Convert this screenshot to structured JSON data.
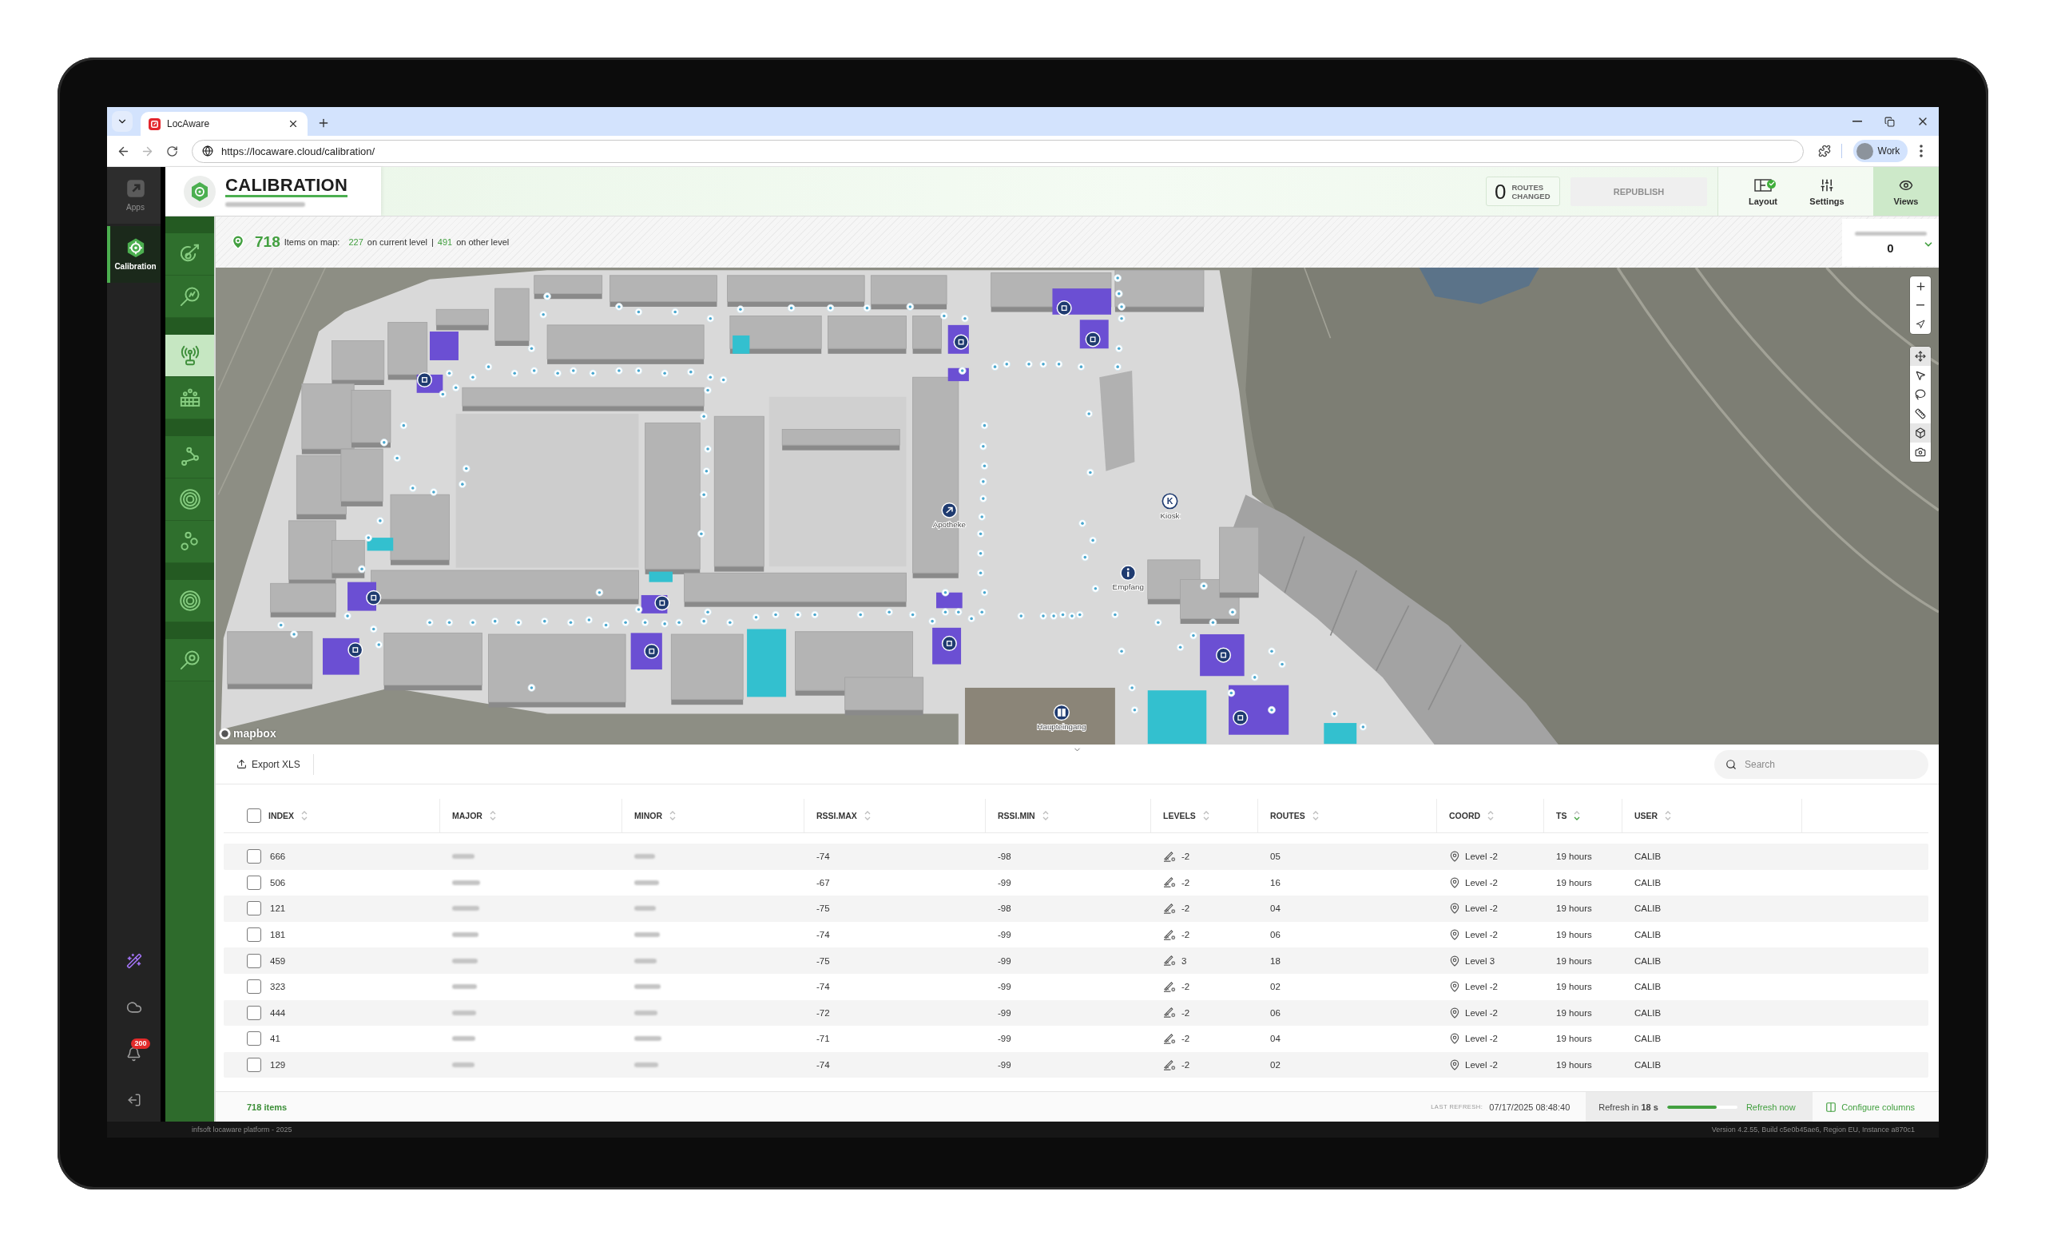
{
  "browser": {
    "tab_title": "LocAware",
    "url": "https://locaware.cloud/calibration/",
    "profile": "Work"
  },
  "sidebar": {
    "items": [
      {
        "label": "Apps",
        "selected": false
      },
      {
        "label": "Calibration",
        "selected": true
      }
    ],
    "notification_badge": "200"
  },
  "header": {
    "title": "CALIBRATION",
    "routes_count": "0",
    "routes_label": "ROUTES CHANGED",
    "republish": {
      "label": "REPUBLISH",
      "disabled": true
    },
    "actions": [
      {
        "label": "Layout",
        "checked": true,
        "selected": false
      },
      {
        "label": "Settings",
        "checked": false,
        "selected": false
      },
      {
        "label": "Views",
        "checked": false,
        "selected": true
      }
    ]
  },
  "tool_groups": [
    {
      "items": [
        {
          "selected": false
        },
        {
          "selected": false
        }
      ]
    },
    {
      "items": [
        {
          "selected": true
        },
        {
          "selected": false
        }
      ]
    },
    {
      "items": [
        {
          "selected": false
        },
        {
          "selected": false
        },
        {
          "selected": false
        }
      ]
    },
    {
      "items": [
        {
          "selected": false
        }
      ]
    },
    {
      "items": [
        {
          "selected": false
        }
      ]
    }
  ],
  "info_bar": {
    "total": "718",
    "total_label": "Items on map:",
    "current": "227",
    "current_label": "on current level",
    "separator": "|",
    "other": "491",
    "other_label": "on other level",
    "side_value": "0"
  },
  "map": {
    "pois": [
      {
        "label": "Apotheke",
        "kind": "pin"
      },
      {
        "label": "Kiosk",
        "kind": "letter",
        "glyph": "K"
      },
      {
        "label": "Empfang",
        "kind": "info"
      },
      {
        "label": "Haupteingang",
        "kind": "door"
      }
    ],
    "attribution": "mapbox"
  },
  "table": {
    "export_label": "Export XLS",
    "search_placeholder": "Search",
    "select_all": false,
    "columns": [
      {
        "label": "INDEX",
        "sorted": false
      },
      {
        "label": "MAJOR",
        "sorted": false
      },
      {
        "label": "MINOR",
        "sorted": false
      },
      {
        "label": "RSSI.MAX",
        "sorted": false
      },
      {
        "label": "RSSI.MIN",
        "sorted": false
      },
      {
        "label": "LEVELS",
        "sorted": false
      },
      {
        "label": "ROUTES",
        "sorted": false
      },
      {
        "label": "COORD",
        "sorted": false
      },
      {
        "label": "TS",
        "sorted": true
      },
      {
        "label": "USER",
        "sorted": false
      }
    ],
    "rows": [
      {
        "checked": false,
        "index": "666",
        "rssi_max": "-74",
        "rssi_min": "-98",
        "levels": "-2",
        "routes": "05",
        "coord": "Level -2",
        "ts": "19 hours",
        "user": "CALIB"
      },
      {
        "checked": false,
        "index": "506",
        "rssi_max": "-67",
        "rssi_min": "-99",
        "levels": "-2",
        "routes": "16",
        "coord": "Level -2",
        "ts": "19 hours",
        "user": "CALIB"
      },
      {
        "checked": false,
        "index": "121",
        "rssi_max": "-75",
        "rssi_min": "-98",
        "levels": "-2",
        "routes": "04",
        "coord": "Level -2",
        "ts": "19 hours",
        "user": "CALIB"
      },
      {
        "checked": false,
        "index": "181",
        "rssi_max": "-74",
        "rssi_min": "-99",
        "levels": "-2",
        "routes": "06",
        "coord": "Level -2",
        "ts": "19 hours",
        "user": "CALIB"
      },
      {
        "checked": false,
        "index": "459",
        "rssi_max": "-75",
        "rssi_min": "-99",
        "levels": "3",
        "routes": "18",
        "coord": "Level 3",
        "ts": "19 hours",
        "user": "CALIB"
      },
      {
        "checked": false,
        "index": "323",
        "rssi_max": "-74",
        "rssi_min": "-99",
        "levels": "-2",
        "routes": "02",
        "coord": "Level -2",
        "ts": "19 hours",
        "user": "CALIB"
      },
      {
        "checked": false,
        "index": "444",
        "rssi_max": "-72",
        "rssi_min": "-99",
        "levels": "-2",
        "routes": "06",
        "coord": "Level -2",
        "ts": "19 hours",
        "user": "CALIB"
      },
      {
        "checked": false,
        "index": "41",
        "rssi_max": "-71",
        "rssi_min": "-99",
        "levels": "-2",
        "routes": "04",
        "coord": "Level -2",
        "ts": "19 hours",
        "user": "CALIB"
      },
      {
        "checked": false,
        "index": "129",
        "rssi_max": "-74",
        "rssi_min": "-99",
        "levels": "-2",
        "routes": "02",
        "coord": "Level -2",
        "ts": "19 hours",
        "user": "CALIB"
      }
    ]
  },
  "footer": {
    "count": "718 items",
    "last_refresh_label": "LAST REFRESH:",
    "last_refresh": "07/17/2025 08:48:40",
    "refresh_in": "Refresh in **18 s**",
    "level": 0.7,
    "refresh_now": "Refresh now",
    "configure": "Configure columns"
  },
  "status_bar": {
    "left": "infsoft locaware platform - 2025",
    "right": "Version 4.2.55, Build c5e0b45ae6, Region EU, Instance a870c1"
  }
}
